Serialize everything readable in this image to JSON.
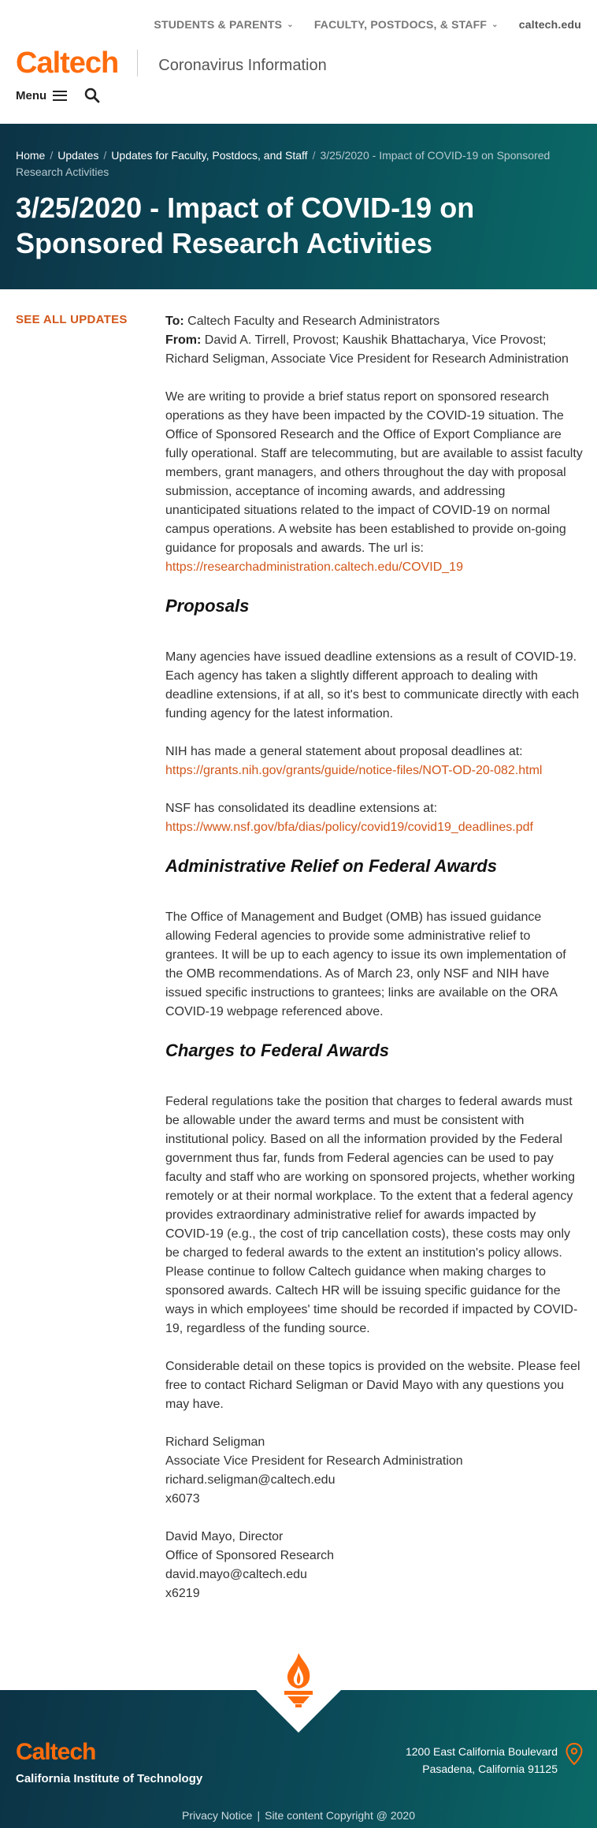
{
  "topnav": {
    "students_parents": "STUDENTS & PARENTS",
    "faculty_staff": "FACULTY, POSTDOCS, & STAFF",
    "caltech_edu": "caltech.edu"
  },
  "brand": {
    "logo": "Caltech",
    "site_name": "Coronavirus Information"
  },
  "menu": {
    "label": "Menu"
  },
  "breadcrumbs": {
    "home": "Home",
    "updates": "Updates",
    "faculty_updates": "Updates for Faculty, Postdocs, and Staff",
    "current": "3/25/2020 - Impact of COVID-19 on Sponsored Research Activities"
  },
  "page_title": "3/25/2020 - Impact of COVID-19 on Sponsored Research Activities",
  "sidebar": {
    "see_all": "SEE ALL UPDATES"
  },
  "memo": {
    "to_label": "To:",
    "to": "Caltech Faculty and Research Administrators",
    "from_label": "From:",
    "from": "David A. Tirrell, Provost; Kaushik Bhattacharya, Vice Provost; Richard Seligman, Associate Vice President for Research Administration"
  },
  "intro": {
    "text": "We are writing to provide a brief status report on sponsored research operations as they have been impacted by the COVID-19 situation. The Office of Sponsored Research and the Office of Export Compliance are fully operational. Staff are telecommuting, but are available to assist faculty members, grant managers, and others throughout the day with proposal submission, acceptance of incoming awards, and addressing unanticipated situations related to the impact of COVID-19 on normal campus operations. A website has been established to provide on-going guidance for proposals and awards. The url is:",
    "link": "https://researchadministration.caltech.edu/COVID_19"
  },
  "proposals": {
    "heading": "Proposals",
    "p1": "Many agencies have issued deadline extensions as a result of COVID-19. Each agency has taken a slightly different approach to dealing with deadline extensions, if at all, so it's best to communicate directly with each funding agency for the latest information.",
    "nih_text": "NIH has made a general statement about proposal deadlines at:",
    "nih_link": "https://grants.nih.gov/grants/guide/notice-files/NOT-OD-20-082.html",
    "nsf_text": "NSF has consolidated its deadline extensions at:",
    "nsf_link": "https://www.nsf.gov/bfa/dias/policy/covid19/covid19_deadlines.pdf"
  },
  "admin_relief": {
    "heading": "Administrative Relief on Federal Awards",
    "p1": "The Office of Management and Budget (OMB) has issued guidance allowing Federal agencies to provide some administrative relief to grantees. It will be up to each agency to issue its own implementation of the OMB recommendations. As of March 23, only NSF and NIH have issued specific instructions to grantees; links are available on the ORA COVID-19 webpage referenced above."
  },
  "charges": {
    "heading": "Charges to Federal Awards",
    "p1": "Federal regulations take the position that charges to federal awards must be allowable under the award terms and must be consistent with institutional policy. Based on all the information provided by the Federal government thus far, funds from Federal agencies can be used to pay faculty and staff who are working on sponsored projects, whether working remotely or at their normal workplace. To the extent that a federal agency provides extraordinary administrative relief for awards impacted by COVID-19 (e.g., the cost of trip cancellation costs), these costs may only be charged to federal awards to the extent an institution's policy allows. Please continue to follow Caltech guidance when making charges to sponsored awards. Caltech HR will be issuing specific guidance for the ways in which employees' time should be recorded if impacted by COVID-19, regardless of the funding source.",
    "p2": "Considerable detail on these topics is provided on the website. Please feel free to contact Richard Seligman or David Mayo with any questions you may have."
  },
  "signatures": [
    {
      "name": "Richard Seligman",
      "title": "Associate Vice President for Research Administration",
      "email": "richard.seligman@caltech.edu",
      "ext": "x6073"
    },
    {
      "name": "David Mayo, Director",
      "title": "Office of Sponsored Research",
      "email": "david.mayo@caltech.edu",
      "ext": "x6219"
    }
  ],
  "footer": {
    "logo": "Caltech",
    "institution": "California Institute of Technology",
    "address_line1": "1200 East California Boulevard",
    "address_line2": "Pasadena, California 91125",
    "privacy": "Privacy Notice",
    "copyright": "Site content Copyright @ 2020"
  },
  "colors": {
    "brand_orange": "#ff6c0c",
    "link_orange": "#d2571b",
    "hero_teal": "#0b4a58"
  }
}
